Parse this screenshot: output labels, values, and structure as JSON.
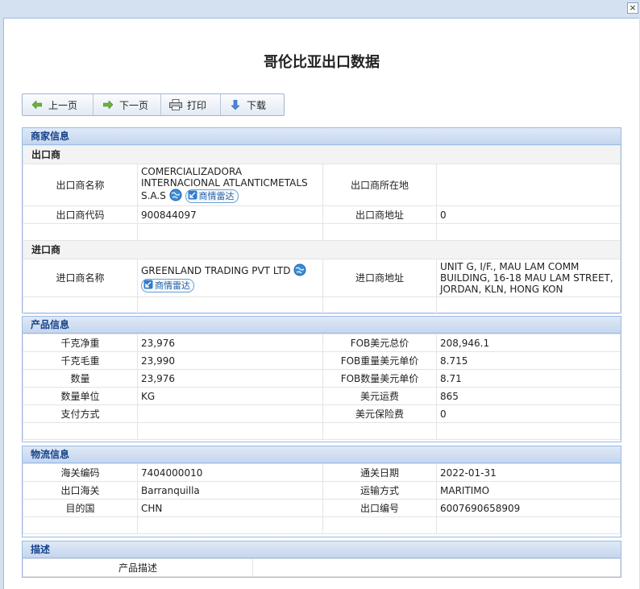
{
  "window": {
    "close_glyph": "×"
  },
  "page": {
    "title": "哥伦比亚出口数据"
  },
  "toolbar": {
    "prev": "上一页",
    "next": "下一页",
    "print": "打印",
    "download": "下载"
  },
  "merchant": {
    "header": "商家信息",
    "exporter": {
      "section_label": "出口商",
      "name_label": "出口商名称",
      "name_value": "COMERCIALIZADORA INTERNACIONAL ATLANTICMETALS S.A.S",
      "radar_label": "商情雷达",
      "location_label": "出口商所在地",
      "location_value": "",
      "code_label": "出口商代码",
      "code_value": "900844097",
      "address_label": "出口商地址",
      "address_value": "0"
    },
    "importer": {
      "section_label": "进口商",
      "name_label": "进口商名称",
      "name_value": "GREENLAND TRADING PVT LTD",
      "radar_label": "商情雷达",
      "address_label": "进口商地址",
      "address_value": "UNIT G, I/F., MAU LAM COMM BUILDING, 16-18 MAU LAM STREET, JORDAN, KLN, HONG KON"
    }
  },
  "product": {
    "header": "产品信息",
    "rows": [
      {
        "l1": "千克净重",
        "v1": "23,976",
        "l2": "FOB美元总价",
        "v2": "208,946.1"
      },
      {
        "l1": "千克毛重",
        "v1": "23,990",
        "l2": "FOB重量美元单价",
        "v2": "8.715"
      },
      {
        "l1": "数量",
        "v1": "23,976",
        "l2": "FOB数量美元单价",
        "v2": "8.71"
      },
      {
        "l1": "数量单位",
        "v1": "KG",
        "l2": "美元运费",
        "v2": "865"
      },
      {
        "l1": "支付方式",
        "v1": "",
        "l2": "美元保险费",
        "v2": "0"
      }
    ]
  },
  "logistics": {
    "header": "物流信息",
    "rows": [
      {
        "l1": "海关编码",
        "v1": "7404000010",
        "l2": "通关日期",
        "v2": "2022-01-31"
      },
      {
        "l1": "出口海关",
        "v1": "Barranquilla",
        "l2": "运输方式",
        "v2": "MARITIMO"
      },
      {
        "l1": "目的国",
        "v1": "CHN",
        "l2": "出口编号",
        "v2": "6007690658909"
      }
    ]
  },
  "description": {
    "header": "描述",
    "label": "产品描述",
    "value": ""
  },
  "colors": {
    "accent": "#15428b",
    "border": "#99bbe8",
    "toolbar_arrow": "#4ea82a"
  }
}
